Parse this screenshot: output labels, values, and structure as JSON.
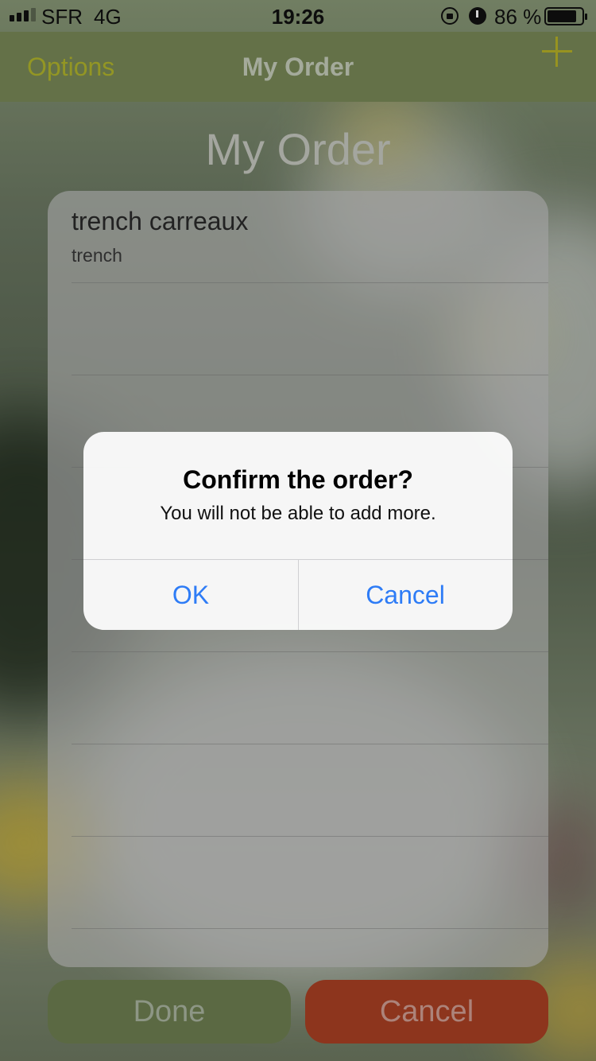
{
  "status_bar": {
    "carrier": "SFR",
    "network": "4G",
    "time": "19:26",
    "battery_percent": "86 %",
    "battery_level": 0.86,
    "icons": [
      "signal-icon",
      "orientation-lock-icon",
      "alarm-icon",
      "battery-icon"
    ]
  },
  "nav": {
    "left_label": "Options",
    "title": "My Order",
    "right_icon": "plus-icon"
  },
  "page_title": "My Order",
  "order_items": [
    {
      "name": "trench carreaux",
      "type": "trench"
    },
    {
      "name": "",
      "type": ""
    },
    {
      "name": "",
      "type": ""
    },
    {
      "name": "",
      "type": ""
    },
    {
      "name": "",
      "type": ""
    },
    {
      "name": "",
      "type": ""
    },
    {
      "name": "",
      "type": ""
    },
    {
      "name": "",
      "type": ""
    }
  ],
  "buttons": {
    "done": "Done",
    "cancel": "Cancel"
  },
  "alert": {
    "title": "Confirm the order?",
    "message": "You will not be able to add more.",
    "ok": "OK",
    "cancel": "Cancel"
  },
  "colors": {
    "nav_bar": "#7a8a58",
    "accent": "#b4b82c",
    "done_button": "#6f8052",
    "cancel_button": "#ad4124",
    "alert_action": "#2e7cf6"
  }
}
